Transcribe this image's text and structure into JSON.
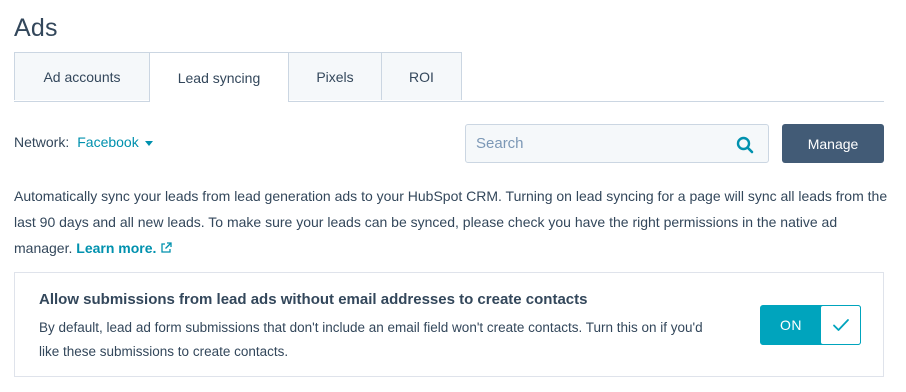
{
  "page": {
    "title": "Ads"
  },
  "tabs": [
    {
      "label": "Ad accounts",
      "active": false
    },
    {
      "label": "Lead syncing",
      "active": true
    },
    {
      "label": "Pixels",
      "active": false
    },
    {
      "label": "ROI",
      "active": false
    }
  ],
  "network": {
    "label": "Network:",
    "value": "Facebook"
  },
  "search": {
    "placeholder": "Search",
    "value": ""
  },
  "manage_button": {
    "label": "Manage"
  },
  "description": {
    "text": "Automatically sync your leads from lead generation ads to your HubSpot CRM. Turning on lead syncing for a page will sync all leads from the last 90 days and all new leads. To make sure your leads can be synced, please check you have the right permissions in the native ad manager.",
    "link": "Learn more."
  },
  "setting_card": {
    "title": "Allow submissions from lead ads without email addresses to create contacts",
    "body": "By default, lead ad form submissions that don't include an email field won't create contacts. Turn this on if you'd like these submissions to create contacts.",
    "toggle_label": "ON",
    "toggle_state": true
  },
  "colors": {
    "text": "#33475b",
    "link": "#0091ae",
    "accent": "#00a4bd",
    "button": "#425b76",
    "border": "#cbd6e2"
  }
}
